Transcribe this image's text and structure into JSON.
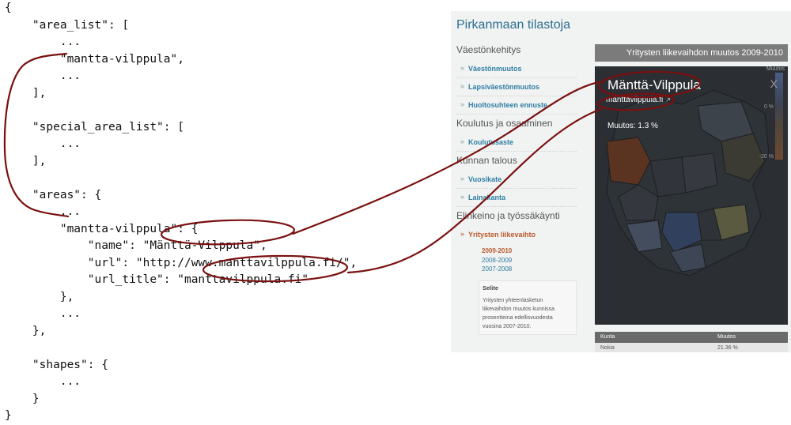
{
  "code_lines": [
    "{",
    "    \"area_list\": [",
    "        ...",
    "        \"mantta-vilppula\",",
    "        ...",
    "    ],",
    "",
    "    \"special_area_list\": [",
    "        ...",
    "    ],",
    "",
    "    \"areas\": {",
    "        ...",
    "        \"mantta-vilppula\": {",
    "            \"name\": \"Mänttä-Vilppula\",",
    "            \"url\": \"http://www.manttavilppula.fi/\",",
    "            \"url_title\": \"manttavilppula.fi\"",
    "        },",
    "        ...",
    "    },",
    "",
    "    \"shapes\": {",
    "        ...",
    "    }",
    "}"
  ],
  "screenshot": {
    "title": "Pirkanmaan tilastoja",
    "sections": [
      {
        "heading": "Väestönkehitys",
        "items": [
          "Väestönmuutos",
          "Lapsiväestönmuutos",
          "Huoltosuhteen ennuste"
        ]
      },
      {
        "heading": "Koulutus ja osaaminen",
        "items": [
          "Koulutusaste"
        ]
      },
      {
        "heading": "Kunnan talous",
        "items": [
          "Vuosikate",
          "Lainakanta"
        ]
      },
      {
        "heading": "Elinkeino ja työssäkäynti",
        "items": [
          "Yritysten liikevaihto"
        ]
      }
    ],
    "years": [
      "2009-2010",
      "2008-2009",
      "2007-2008"
    ],
    "selite_title": "Selite",
    "selite_text": "Yritysten yhteenlasketun liikevaihdon muutos kunnissa prosentteina edellisvuodesta vuosina 2007-2010.",
    "map_header": "Yritysten liikevaihdon muutos 2009-2010",
    "popup": {
      "name": "Mänttä-Vilppula",
      "link": "manttavilppula.fi",
      "change": "Muutos: 1.3 %",
      "close": "X"
    },
    "legend": {
      "title": "Muutos",
      "label_1": "0 %",
      "label_2": "-20 %"
    },
    "table": {
      "headers": [
        "Kunta",
        "Muutos"
      ],
      "row": [
        "Nokia",
        "21.36 %"
      ]
    }
  },
  "colors": {
    "annotation": "#7a1010",
    "link": "#2f7fa3",
    "active": "#b85a2a",
    "map_bg": "#2b2f33"
  }
}
